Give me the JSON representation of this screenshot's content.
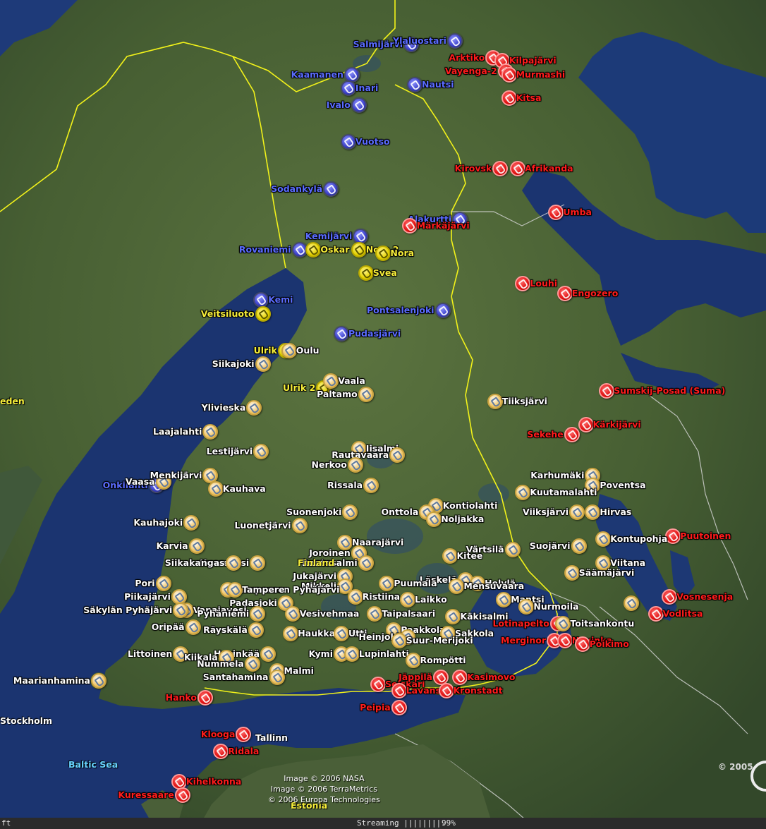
{
  "colors": {
    "sea": "#1c3a78",
    "land": "#4e6a3a",
    "border_yellow": "#f2f21a",
    "border_white": "#d8d8d8",
    "label_white": "#ffffff",
    "label_yellow": "#f6ee3a",
    "label_red": "#ff1c1c",
    "label_blue": "#5a6cff",
    "sea_label": "#67d3ff"
  },
  "labels": {
    "sea": "Baltic Sea",
    "country": "Finland",
    "estonia": "Estonia",
    "sweden": "eden",
    "stockholm": "Stockholm",
    "tallinn": "Tallinn"
  },
  "credits": {
    "nasa": "Image © 2006 NASA",
    "terrametrics": "Image © 2006 TerraMetrics",
    "europa": "© 2006 Europa Technologies",
    "copyright": "© 2005"
  },
  "status": {
    "left": "ft",
    "streaming": "Streaming ||||||||.",
    "percent": "99%"
  },
  "placemark_categories": {
    "white": "pushpin-white-icon",
    "yellow": "pushpin-yellow-icon",
    "red": "pushpin-red-icon",
    "blue": "pushpin-blue-icon"
  },
  "placemarks": [
    {
      "name": "Salmijärvi",
      "color": "blue",
      "lon": 28.9,
      "lat": 69.55,
      "side": "left"
    },
    {
      "name": "Ylaluostari",
      "color": "blue",
      "lon": 30.15,
      "lat": 69.6,
      "side": "left"
    },
    {
      "name": "Kaamanen",
      "color": "blue",
      "lon": 27.2,
      "lat": 69.1,
      "side": "left"
    },
    {
      "name": "Nautsi",
      "color": "blue",
      "lon": 29.0,
      "lat": 68.95,
      "side": "right"
    },
    {
      "name": "Inari",
      "color": "blue",
      "lon": 27.1,
      "lat": 68.9,
      "side": "right"
    },
    {
      "name": "Ivalo",
      "color": "blue",
      "lon": 27.4,
      "lat": 68.65,
      "side": "left"
    },
    {
      "name": "Vuotso",
      "color": "blue",
      "lon": 27.1,
      "lat": 68.1,
      "side": "right"
    },
    {
      "name": "Sodankylä",
      "color": "blue",
      "lon": 26.6,
      "lat": 67.4,
      "side": "left"
    },
    {
      "name": "Alakurtti",
      "color": "blue",
      "lon": 30.3,
      "lat": 66.95,
      "side": "left"
    },
    {
      "name": "Kemijärvi",
      "color": "blue",
      "lon": 27.45,
      "lat": 66.7,
      "side": "left"
    },
    {
      "name": "Rovaniemi",
      "color": "blue",
      "lon": 25.7,
      "lat": 66.5,
      "side": "left"
    },
    {
      "name": "Pontsalenjoki",
      "color": "blue",
      "lon": 29.8,
      "lat": 65.6,
      "side": "left"
    },
    {
      "name": "Kemi",
      "color": "blue",
      "lon": 24.6,
      "lat": 65.75,
      "side": "right"
    },
    {
      "name": "Pudasjärvi",
      "color": "blue",
      "lon": 26.9,
      "lat": 65.25,
      "side": "right"
    },
    {
      "name": "Onkilahti",
      "color": "blue",
      "lon": 21.6,
      "lat": 63.0,
      "side": "left"
    },
    {
      "name": "Oskar",
      "color": "yellow",
      "lon": 26.1,
      "lat": 66.5,
      "side": "right"
    },
    {
      "name": "Nora 2",
      "color": "yellow",
      "lon": 27.4,
      "lat": 66.5,
      "side": "right"
    },
    {
      "name": "Nora",
      "color": "yellow",
      "lon": 28.1,
      "lat": 66.45,
      "side": "right"
    },
    {
      "name": "Svea",
      "color": "yellow",
      "lon": 27.6,
      "lat": 66.15,
      "side": "right"
    },
    {
      "name": "Veitsiluoto",
      "color": "yellow",
      "lon": 24.65,
      "lat": 65.55,
      "side": "left"
    },
    {
      "name": "Ulrik",
      "color": "yellow",
      "lon": 25.3,
      "lat": 65.0,
      "side": "left"
    },
    {
      "name": "Ulrik 2",
      "color": "yellow",
      "lon": 26.4,
      "lat": 64.45,
      "side": "left"
    },
    {
      "name": "Arktiko",
      "color": "red",
      "lon": 31.25,
      "lat": 69.35,
      "side": "left"
    },
    {
      "name": "Kilpajärvi",
      "color": "red",
      "lon": 31.5,
      "lat": 69.3,
      "side": "right"
    },
    {
      "name": "Vayenga-2",
      "color": "red",
      "lon": 31.6,
      "lat": 69.15,
      "side": "left"
    },
    {
      "name": "Murmashi",
      "color": "red",
      "lon": 31.7,
      "lat": 69.1,
      "side": "right"
    },
    {
      "name": "Kitsa",
      "color": "red",
      "lon": 31.7,
      "lat": 68.75,
      "side": "right"
    },
    {
      "name": "Kirovsk",
      "color": "red",
      "lon": 31.45,
      "lat": 67.7,
      "side": "left"
    },
    {
      "name": "Afrikanda",
      "color": "red",
      "lon": 31.95,
      "lat": 67.7,
      "side": "right"
    },
    {
      "name": "Umba",
      "color": "red",
      "lon": 33.05,
      "lat": 67.05,
      "side": "right"
    },
    {
      "name": "Märkäjärvi",
      "color": "red",
      "lon": 28.85,
      "lat": 66.85,
      "side": "right"
    },
    {
      "name": "Louhi",
      "color": "red",
      "lon": 32.1,
      "lat": 66.0,
      "side": "right"
    },
    {
      "name": "Engozero",
      "color": "red",
      "lon": 33.3,
      "lat": 65.85,
      "side": "right"
    },
    {
      "name": "Sumskij-Posad (Suma)",
      "color": "red",
      "lon": 34.5,
      "lat": 64.4,
      "side": "right"
    },
    {
      "name": "Kärkijärvi",
      "color": "red",
      "lon": 33.9,
      "lat": 63.9,
      "side": "right"
    },
    {
      "name": "Sekehe",
      "color": "red",
      "lon": 33.5,
      "lat": 63.75,
      "side": "left"
    },
    {
      "name": "Puutoinen",
      "color": "red",
      "lon": 36.4,
      "lat": 62.25,
      "side": "right"
    },
    {
      "name": "Vosnesenja",
      "color": "red",
      "lon": 36.3,
      "lat": 61.35,
      "side": "right"
    },
    {
      "name": "Vodlitsa",
      "color": "red",
      "lon": 35.9,
      "lat": 61.1,
      "side": "right"
    },
    {
      "name": "Lotinapelto",
      "color": "red",
      "lon": 33.1,
      "lat": 60.95,
      "side": "left"
    },
    {
      "name": "Merginor",
      "color": "red",
      "lon": 33.0,
      "lat": 60.7,
      "side": "left"
    },
    {
      "name": "Novinka",
      "color": "red",
      "lon": 33.3,
      "lat": 60.7,
      "side": "right"
    },
    {
      "name": "Poikimo",
      "color": "red",
      "lon": 33.8,
      "lat": 60.65,
      "side": "right"
    },
    {
      "name": "Hanko",
      "color": "red",
      "lon": 23.0,
      "lat": 59.85,
      "side": "left"
    },
    {
      "name": "Seiskari",
      "color": "red",
      "lon": 27.95,
      "lat": 60.05,
      "side": "right"
    },
    {
      "name": "Lavansaari",
      "color": "red",
      "lon": 28.55,
      "lat": 59.95,
      "side": "right"
    },
    {
      "name": "Jäppilä",
      "color": "red",
      "lon": 29.75,
      "lat": 60.15,
      "side": "left"
    },
    {
      "name": "Kasimovo",
      "color": "red",
      "lon": 30.3,
      "lat": 60.15,
      "side": "right"
    },
    {
      "name": "Kronstadt",
      "color": "red",
      "lon": 29.9,
      "lat": 59.95,
      "side": "right"
    },
    {
      "name": "Peipia",
      "color": "red",
      "lon": 28.55,
      "lat": 59.7,
      "side": "left"
    },
    {
      "name": "Klooga",
      "color": "red",
      "lon": 24.1,
      "lat": 59.3,
      "side": "left"
    },
    {
      "name": "Ridala",
      "color": "red",
      "lon": 23.45,
      "lat": 59.05,
      "side": "right"
    },
    {
      "name": "Kihelkonna",
      "color": "red",
      "lon": 22.25,
      "lat": 58.6,
      "side": "right"
    },
    {
      "name": "Kuressaare",
      "color": "red",
      "lon": 22.35,
      "lat": 58.4,
      "side": "left"
    },
    {
      "name": "Oulu",
      "color": "white",
      "lon": 25.4,
      "lat": 65.0,
      "side": "right"
    },
    {
      "name": "Siikajoki",
      "color": "white",
      "lon": 24.65,
      "lat": 64.8,
      "side": "left"
    },
    {
      "name": "Vaala",
      "color": "white",
      "lon": 26.6,
      "lat": 64.55,
      "side": "right"
    },
    {
      "name": "Paltamo",
      "color": "white",
      "lon": 27.6,
      "lat": 64.35,
      "side": "left"
    },
    {
      "name": "Tiiksjärvi",
      "color": "white",
      "lon": 31.3,
      "lat": 64.25,
      "side": "right"
    },
    {
      "name": "Ylivieska",
      "color": "white",
      "lon": 24.4,
      "lat": 64.15,
      "side": "left"
    },
    {
      "name": "Laajalahti",
      "color": "white",
      "lon": 23.15,
      "lat": 63.8,
      "side": "left"
    },
    {
      "name": "Iisalmi",
      "color": "white",
      "lon": 27.4,
      "lat": 63.55,
      "side": "right"
    },
    {
      "name": "Rautavaara",
      "color": "white",
      "lon": 28.5,
      "lat": 63.45,
      "side": "left"
    },
    {
      "name": "Lestijärvi",
      "color": "white",
      "lon": 24.6,
      "lat": 63.5,
      "side": "left"
    },
    {
      "name": "Nerkoo",
      "color": "white",
      "lon": 27.3,
      "lat": 63.3,
      "side": "left"
    },
    {
      "name": "Vaasa",
      "color": "white",
      "lon": 21.8,
      "lat": 63.05,
      "side": "left"
    },
    {
      "name": "Menkijärvi",
      "color": "white",
      "lon": 23.15,
      "lat": 63.15,
      "side": "left"
    },
    {
      "name": "Kauhava",
      "color": "white",
      "lon": 23.3,
      "lat": 62.95,
      "side": "right"
    },
    {
      "name": "Rissala",
      "color": "white",
      "lon": 27.75,
      "lat": 63.0,
      "side": "left"
    },
    {
      "name": "Karhumäki",
      "color": "white",
      "lon": 34.1,
      "lat": 63.15,
      "side": "left"
    },
    {
      "name": "Poventsa",
      "color": "white",
      "lon": 34.1,
      "lat": 63.0,
      "side": "right"
    },
    {
      "name": "Kuutamalahti",
      "color": "white",
      "lon": 32.1,
      "lat": 62.9,
      "side": "right"
    },
    {
      "name": "Kontiolahti",
      "color": "white",
      "lon": 29.6,
      "lat": 62.7,
      "side": "right"
    },
    {
      "name": "Onttola",
      "color": "white",
      "lon": 29.35,
      "lat": 62.6,
      "side": "left"
    },
    {
      "name": "Suonenjoki",
      "color": "white",
      "lon": 27.15,
      "lat": 62.6,
      "side": "left"
    },
    {
      "name": "Noljakka",
      "color": "white",
      "lon": 29.55,
      "lat": 62.5,
      "side": "right"
    },
    {
      "name": "Viiksjärvi",
      "color": "white",
      "lon": 33.65,
      "lat": 62.6,
      "side": "left"
    },
    {
      "name": "Hirvas",
      "color": "white",
      "lon": 34.1,
      "lat": 62.6,
      "side": "right"
    },
    {
      "name": "Kauhajoki",
      "color": "white",
      "lon": 22.6,
      "lat": 62.45,
      "side": "left"
    },
    {
      "name": "Luonetjärvi",
      "color": "white",
      "lon": 25.7,
      "lat": 62.4,
      "side": "left"
    },
    {
      "name": "Kontupohja",
      "color": "white",
      "lon": 34.4,
      "lat": 62.2,
      "side": "right"
    },
    {
      "name": "Värtsilä",
      "color": "white",
      "lon": 31.8,
      "lat": 62.05,
      "side": "left"
    },
    {
      "name": "Suojärvi",
      "color": "white",
      "lon": 33.7,
      "lat": 62.1,
      "side": "left"
    },
    {
      "name": "Naarajärvi",
      "color": "white",
      "lon": 27.0,
      "lat": 62.15,
      "side": "right"
    },
    {
      "name": "Karvia",
      "color": "white",
      "lon": 22.75,
      "lat": 62.1,
      "side": "left"
    },
    {
      "name": "Kitee",
      "color": "white",
      "lon": 30.0,
      "lat": 61.95,
      "side": "right"
    },
    {
      "name": "Joroinen",
      "color": "white",
      "lon": 27.4,
      "lat": 62.0,
      "side": "left"
    },
    {
      "name": "Viitana",
      "color": "white",
      "lon": 34.4,
      "lat": 61.85,
      "side": "right"
    },
    {
      "name": "Säämäjärvi",
      "color": "white",
      "lon": 33.5,
      "lat": 61.7,
      "side": "right"
    },
    {
      "name": "Kuorevesi",
      "color": "white",
      "lon": 24.5,
      "lat": 61.85,
      "side": "left"
    },
    {
      "name": "Rantasalmi",
      "color": "white",
      "lon": 27.6,
      "lat": 61.85,
      "side": "left"
    },
    {
      "name": "Siikakangas",
      "color": "white",
      "lon": 23.8,
      "lat": 61.85,
      "side": "left"
    },
    {
      "name": "Läskelä",
      "color": "white",
      "lon": 30.45,
      "lat": 61.6,
      "side": "left"
    },
    {
      "name": "Helylä",
      "color": "white",
      "lon": 30.8,
      "lat": 61.55,
      "side": "right"
    },
    {
      "name": "Jukajärvi",
      "color": "white",
      "lon": 27.0,
      "lat": 61.65,
      "side": "left"
    },
    {
      "name": "Mensuvaara",
      "color": "white",
      "lon": 30.2,
      "lat": 61.5,
      "side": "right"
    },
    {
      "name": "Pori",
      "color": "white",
      "lon": 21.8,
      "lat": 61.55,
      "side": "left"
    },
    {
      "name": "Puumala",
      "color": "white",
      "lon": 28.2,
      "lat": 61.55,
      "side": "right"
    },
    {
      "name": "Mikkeli",
      "color": "white",
      "lon": 27.0,
      "lat": 61.5,
      "side": "left"
    },
    {
      "name": "Tampereen Pyhäjärvi",
      "color": "white",
      "lon": 23.65,
      "lat": 61.45,
      "side": "right"
    },
    {
      "name": "Tampere",
      "color": "white",
      "lon": 23.85,
      "lat": 61.45,
      "side": "right"
    },
    {
      "name": "Ristiina",
      "color": "white",
      "lon": 27.3,
      "lat": 61.35,
      "side": "right"
    },
    {
      "name": "Mantsi",
      "color": "white",
      "lon": 31.55,
      "lat": 61.3,
      "side": "right"
    },
    {
      "name": "Piikajärvi",
      "color": "white",
      "lon": 22.25,
      "lat": 61.35,
      "side": "left"
    },
    {
      "name": "Padasjoki",
      "color": "white",
      "lon": 25.3,
      "lat": 61.25,
      "side": "left"
    },
    {
      "name": "Laikko",
      "color": "white",
      "lon": 28.8,
      "lat": 61.3,
      "side": "right"
    },
    {
      "name": "Nurmoila",
      "color": "white",
      "lon": 32.2,
      "lat": 61.2,
      "side": "right"
    },
    {
      "name": "Vosnesenja",
      "color": "white",
      "lon": 35.2,
      "lat": 61.25,
      "side": "none"
    },
    {
      "name": "Vanajavesi",
      "color": "white",
      "lon": 22.45,
      "lat": 61.15,
      "side": "right"
    },
    {
      "name": "Säkylän Pyhäjärvi",
      "color": "white",
      "lon": 22.3,
      "lat": 61.15,
      "side": "left"
    },
    {
      "name": "Pyhäniemi",
      "color": "white",
      "lon": 24.5,
      "lat": 61.1,
      "side": "left"
    },
    {
      "name": "Vesivehmaa",
      "color": "white",
      "lon": 25.5,
      "lat": 61.1,
      "side": "right"
    },
    {
      "name": "Taipalsaari",
      "color": "white",
      "lon": 27.85,
      "lat": 61.1,
      "side": "right"
    },
    {
      "name": "Käkisalmi",
      "color": "white",
      "lon": 30.1,
      "lat": 61.05,
      "side": "right"
    },
    {
      "name": "Toitsankontu",
      "color": "white",
      "lon": 33.25,
      "lat": 60.95,
      "side": "right"
    },
    {
      "name": "Oripää",
      "color": "white",
      "lon": 22.65,
      "lat": 60.9,
      "side": "left"
    },
    {
      "name": "Räyskälä",
      "color": "white",
      "lon": 24.45,
      "lat": 60.85,
      "side": "left"
    },
    {
      "name": "Haukkajärvi",
      "color": "white",
      "lon": 25.45,
      "lat": 60.8,
      "side": "right"
    },
    {
      "name": "Paakkola",
      "color": "white",
      "lon": 28.4,
      "lat": 60.85,
      "side": "right"
    },
    {
      "name": "Sakkola",
      "color": "white",
      "lon": 29.95,
      "lat": 60.8,
      "side": "right"
    },
    {
      "name": "Utti",
      "color": "white",
      "lon": 26.9,
      "lat": 60.8,
      "side": "right"
    },
    {
      "name": "Heinjoki",
      "color": "white",
      "lon": 28.8,
      "lat": 60.75,
      "side": "left"
    },
    {
      "name": "Suur-Merijoki",
      "color": "white",
      "lon": 28.55,
      "lat": 60.7,
      "side": "right"
    },
    {
      "name": "Littoinen",
      "color": "white",
      "lon": 22.3,
      "lat": 60.5,
      "side": "left"
    },
    {
      "name": "Hyvinkää",
      "color": "white",
      "lon": 24.8,
      "lat": 60.5,
      "side": "left"
    },
    {
      "name": "Kymi",
      "color": "white",
      "lon": 26.9,
      "lat": 60.5,
      "side": "left"
    },
    {
      "name": "Lupinlahti",
      "color": "white",
      "lon": 27.2,
      "lat": 60.5,
      "side": "right"
    },
    {
      "name": "Kiikala",
      "color": "white",
      "lon": 23.6,
      "lat": 60.45,
      "side": "left"
    },
    {
      "name": "Rompötti",
      "color": "white",
      "lon": 28.95,
      "lat": 60.4,
      "side": "right"
    },
    {
      "name": "Maarianhamina",
      "color": "white",
      "lon": 19.95,
      "lat": 60.1,
      "side": "left"
    },
    {
      "name": "Nummela",
      "color": "white",
      "lon": 24.35,
      "lat": 60.35,
      "side": "left"
    },
    {
      "name": "Malmi",
      "color": "white",
      "lon": 25.05,
      "lat": 60.25,
      "side": "right"
    },
    {
      "name": "Santahamina",
      "color": "white",
      "lon": 25.05,
      "lat": 60.15,
      "side": "left"
    }
  ]
}
